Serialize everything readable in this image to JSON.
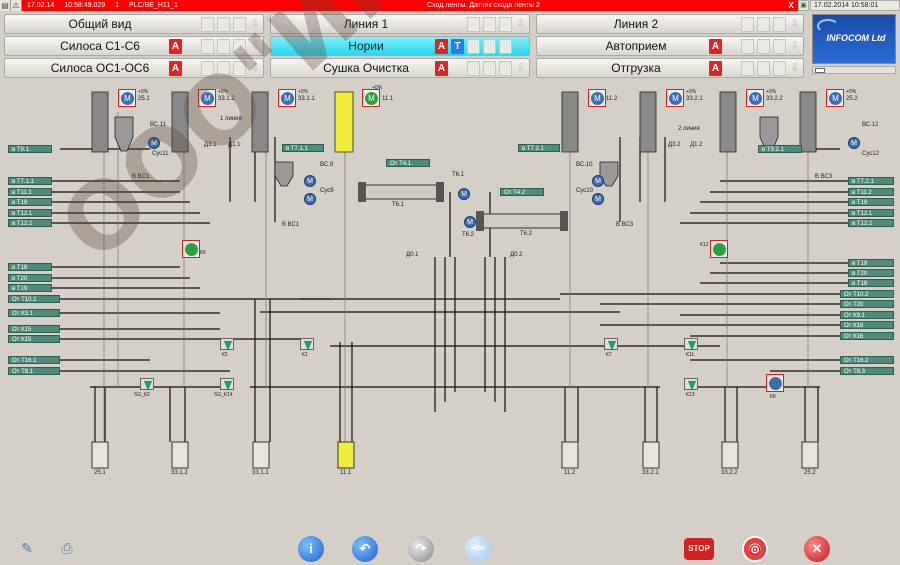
{
  "alarm": {
    "date": "17.02.14",
    "time": "10:58:49.029",
    "priority": "1",
    "tag": "PLC/BE_H11_1",
    "message": "Сход ленты. Датчик схода ленты 2",
    "close": "X"
  },
  "clock": "17.02.2014 10:58:01",
  "nav": {
    "row1": [
      "Общий вид",
      "Линия 1",
      "Линия 2"
    ],
    "row2": [
      "Силоса С1-С6",
      "Нории",
      "Автоприем"
    ],
    "row3": [
      "Силоса ОС1-ОС6",
      "Сушка Очистка",
      "Отгрузка"
    ],
    "flag_a": "A",
    "flag_t": "T",
    "arrow": "⇩"
  },
  "logo": "INFOCOM Ltd",
  "left_tags": [
    "в Т9.1",
    "в Т7.1.1",
    "в Т11.1",
    "в Т19",
    "в Т12.1",
    "в Т12.2",
    "в Т18",
    "в Т20",
    "в Т19",
    "От Т10.1",
    "От К3.1",
    "От К15",
    "От К15",
    "От Т16.1",
    "От Т8.1"
  ],
  "right_tags": [
    "в Т9.2.1",
    "в Т7.2.1",
    "в Т11.2",
    "в Т19",
    "в Т12.1",
    "в Т12.2",
    "в Т19",
    "в Т20",
    "в Т18",
    "От Т10.2",
    "От Т20",
    "От К9.1",
    "От К16",
    "От К16",
    "От Т16.2",
    "От Т8.3"
  ],
  "center_tags": [
    "в Т7.1.1",
    "От Т4.1",
    "От Т4.2",
    "в Т7.2.1"
  ],
  "elevators_left": [
    "25.1",
    "33.1.2",
    "33.1.1",
    "11.1"
  ],
  "elevators_right": [
    "11.2",
    "33.2.1",
    "33.2.2",
    "25.2"
  ],
  "percent": "+0%",
  "motor_letter": "M",
  "labels": {
    "line1": "1 линия",
    "line2": "2 линия",
    "t61": "Т6.1",
    "t62": "Т6.2",
    "vc1": "В ВС1",
    "vc3": "В ВС3",
    "vc9": "ВС.9",
    "vc10": "ВС.10",
    "vc11": "ВС.11",
    "vc12": "ВС.12",
    "cyc9": "Сус9",
    "cyc10": "Сус10",
    "cyc11": "Сус11",
    "cyc12": "Сус12",
    "d31": "Д3.1",
    "d11": "Д1.1",
    "d32": "Д3.2",
    "d12": "Д1.2",
    "d01": "Д0.1",
    "d02": "Д0.2",
    "k6": "К6",
    "k12": "К12",
    "k5": "К5",
    "k1": "К1",
    "k7": "К7",
    "k11": "К11",
    "k13": "К13",
    "k8": "К8",
    "sg_k2": "SG_К2",
    "sg_k14": "SG_К14"
  },
  "silos": [
    "25.1",
    "33.1.2",
    "33.1.1",
    "11.1",
    "11.2",
    "33.2.1",
    "33.2.2",
    "25.2"
  ],
  "watermark": "ООО\"ИНФОКОМ ЛТД\"",
  "toolbar": {
    "info": "i",
    "hide": "HIDE",
    "stop": "STOP",
    "close": "✕"
  }
}
